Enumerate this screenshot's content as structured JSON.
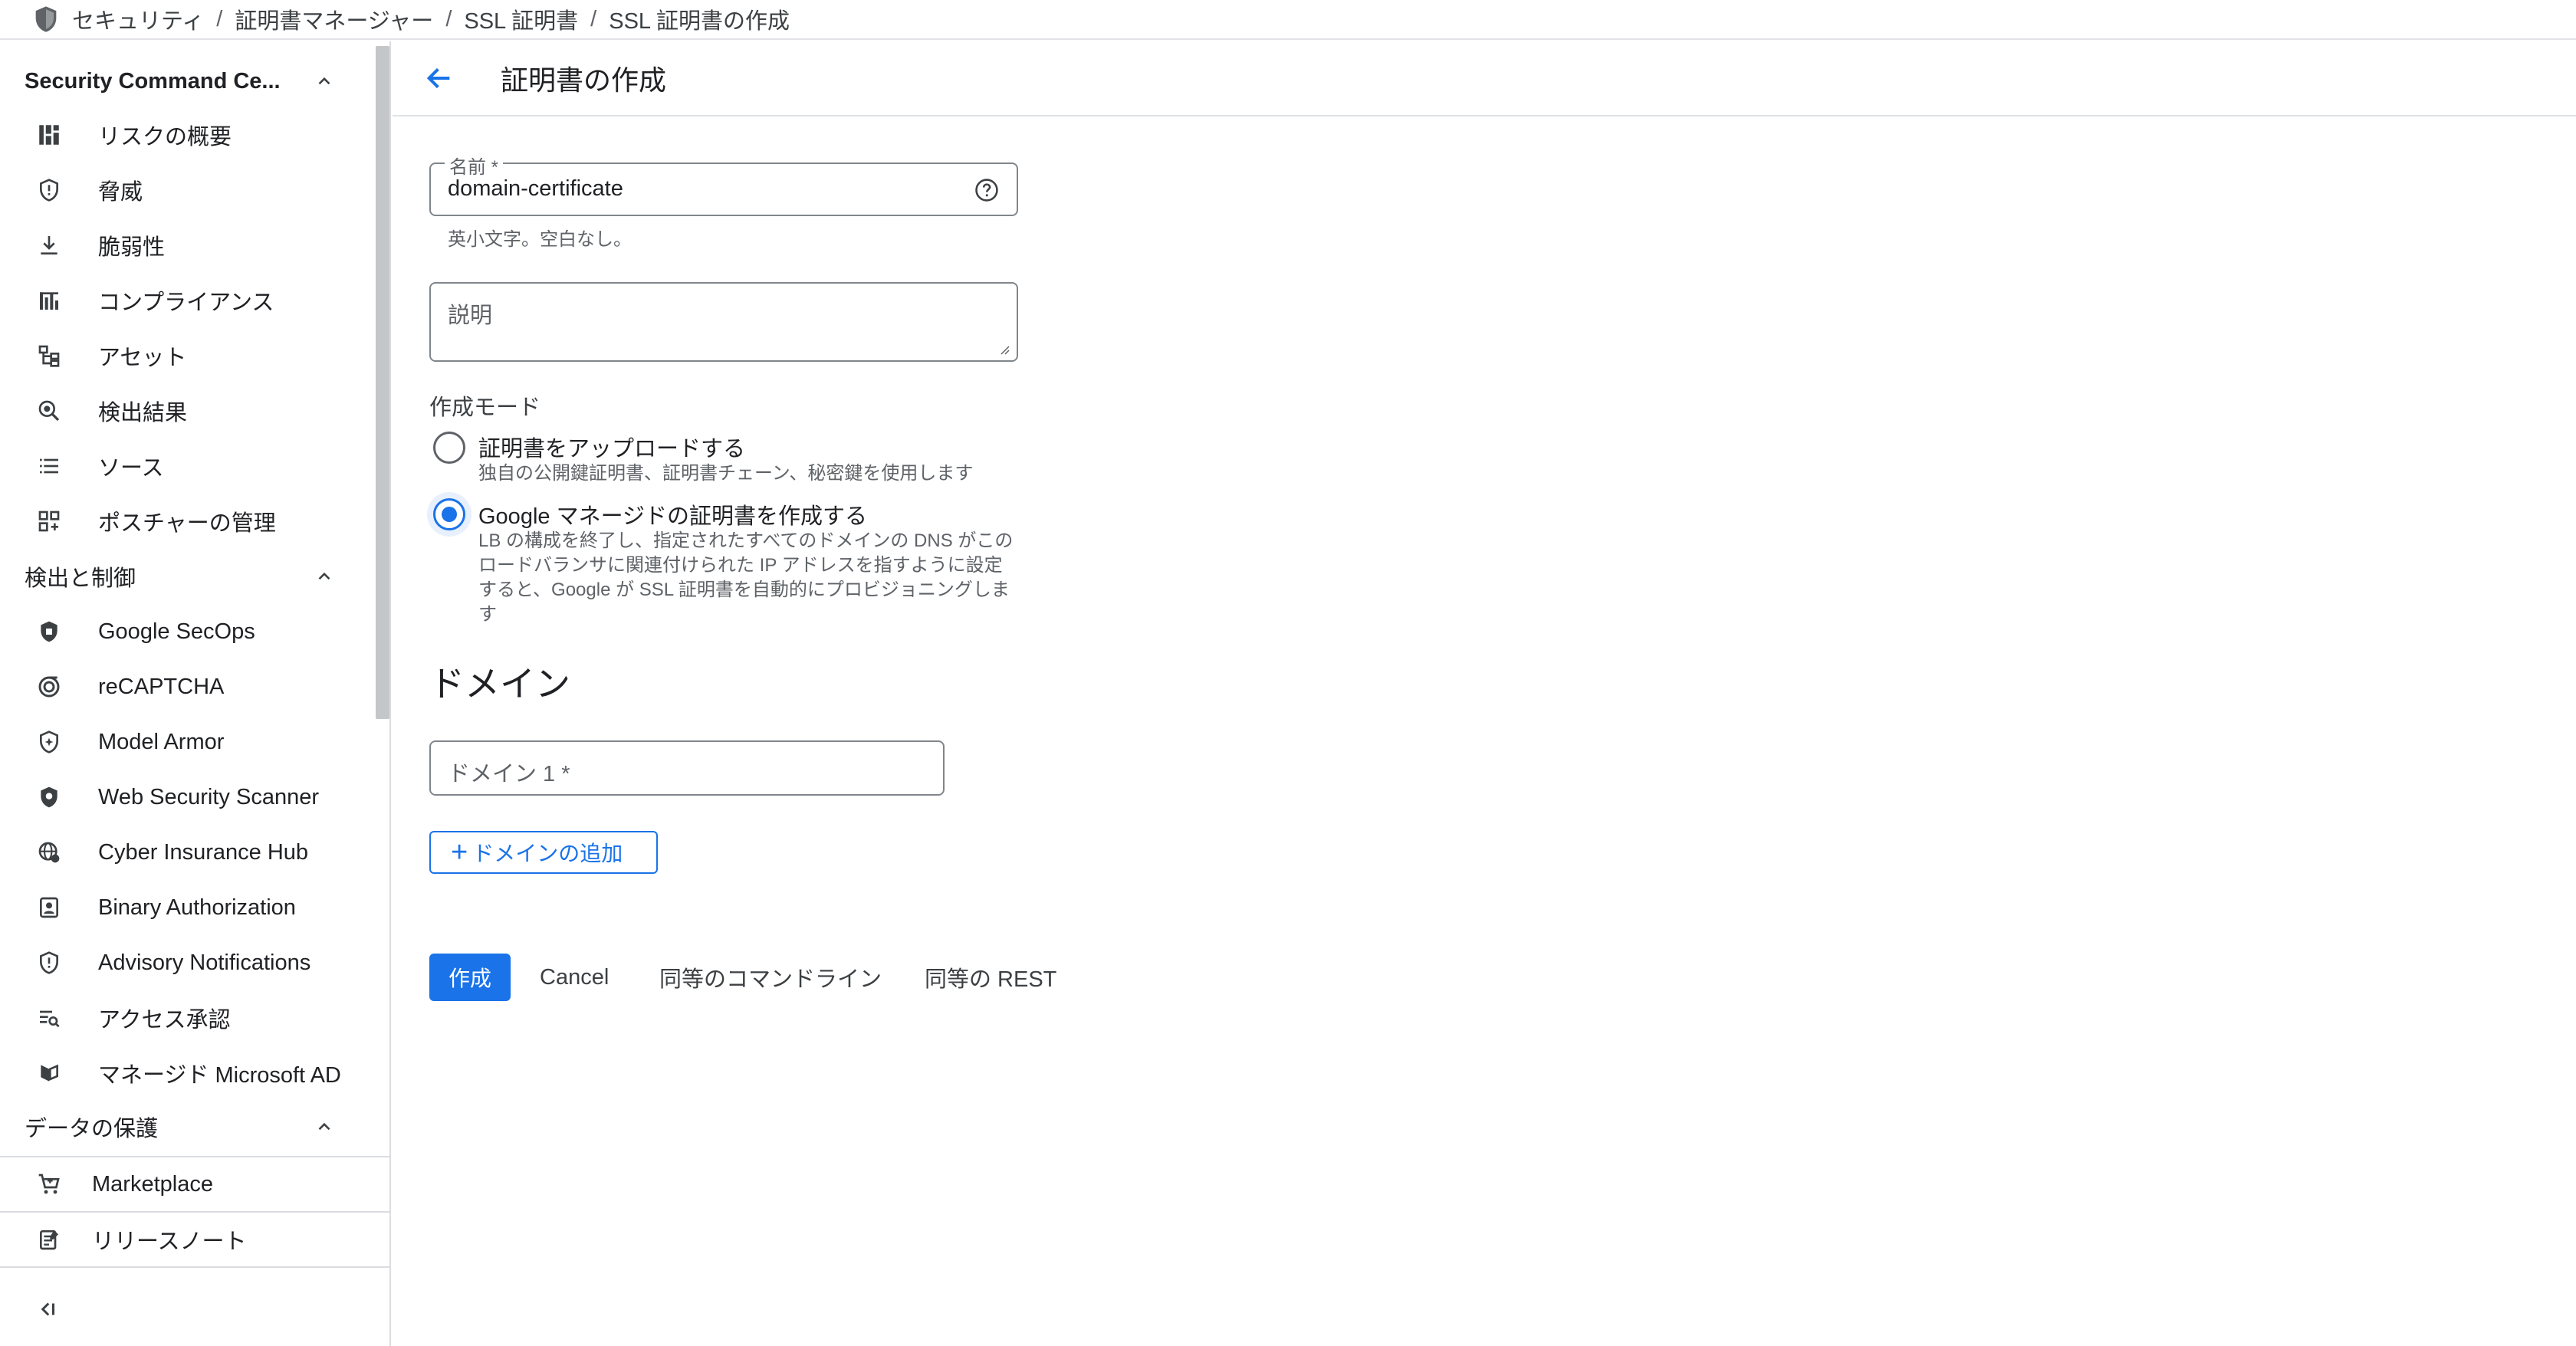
{
  "breadcrumb": [
    "セキュリティ",
    "証明書マネージャー",
    "SSL 証明書",
    "SSL 証明書の作成"
  ],
  "sidebar": {
    "sections": [
      {
        "label": "Security Command Ce...",
        "expanded": true
      },
      {
        "label": "検出と制御",
        "expanded": true
      },
      {
        "label": "データの保護",
        "expanded": true
      }
    ],
    "scc_items": [
      {
        "label": "リスクの概要",
        "icon": "dashboard-icon"
      },
      {
        "label": "脅威",
        "icon": "shield-alert-icon"
      },
      {
        "label": "脆弱性",
        "icon": "download-icon"
      },
      {
        "label": "コンプライアンス",
        "icon": "bar-chart-icon"
      },
      {
        "label": "アセット",
        "icon": "asset-tree-icon"
      },
      {
        "label": "検出結果",
        "icon": "search-findings-icon"
      },
      {
        "label": "ソース",
        "icon": "list-icon"
      },
      {
        "label": "ポスチャーの管理",
        "icon": "posture-icon"
      }
    ],
    "detect_items": [
      {
        "label": "Google SecOps",
        "icon": "secops-icon"
      },
      {
        "label": "reCAPTCHA",
        "icon": "recaptcha-icon"
      },
      {
        "label": "Model Armor",
        "icon": "model-armor-icon"
      },
      {
        "label": "Web Security Scanner",
        "icon": "scanner-shield-icon"
      },
      {
        "label": "Cyber Insurance Hub",
        "icon": "globe-icon"
      },
      {
        "label": "Binary Authorization",
        "icon": "badge-icon"
      },
      {
        "label": "Advisory Notifications",
        "icon": "shield-info-icon"
      },
      {
        "label": "アクセス承認",
        "icon": "list-search-icon"
      },
      {
        "label": "マネージド Microsoft AD",
        "icon": "microsoft-ad-icon"
      }
    ],
    "footer_items": [
      {
        "label": "Marketplace",
        "icon": "cart-icon"
      },
      {
        "label": "リリースノート",
        "icon": "release-notes-icon"
      }
    ]
  },
  "page": {
    "title": "証明書の作成"
  },
  "form": {
    "name_label": "名前 *",
    "name_value": "domain-certificate",
    "name_hint": "英小文字。空白なし。",
    "description_placeholder": "説明",
    "mode_label": "作成モード",
    "modes": [
      {
        "title": "証明書をアップロードする",
        "desc": "独自の公開鍵証明書、証明書チェーン、秘密鍵を使用します",
        "selected": false
      },
      {
        "title": "Google マネージドの証明書を作成する",
        "desc": "LB の構成を終了し、指定されたすべてのドメインの DNS がこのロードバランサに関連付けられた IP アドレスを指すように設定すると、Google が SSL 証明書を自動的にプロビジョニングします",
        "selected": true
      }
    ],
    "domain_heading": "ドメイン",
    "domain_placeholder": "ドメイン 1 *",
    "add_domain_label": "ドメインの追加"
  },
  "actions": {
    "create": "作成",
    "cancel": "Cancel",
    "cli": "同等のコマンドライン",
    "rest": "同等の REST"
  },
  "colors": {
    "accent": "#1a73e8",
    "text": "#202124",
    "muted": "#5f6368",
    "divider": "#dadce0"
  }
}
